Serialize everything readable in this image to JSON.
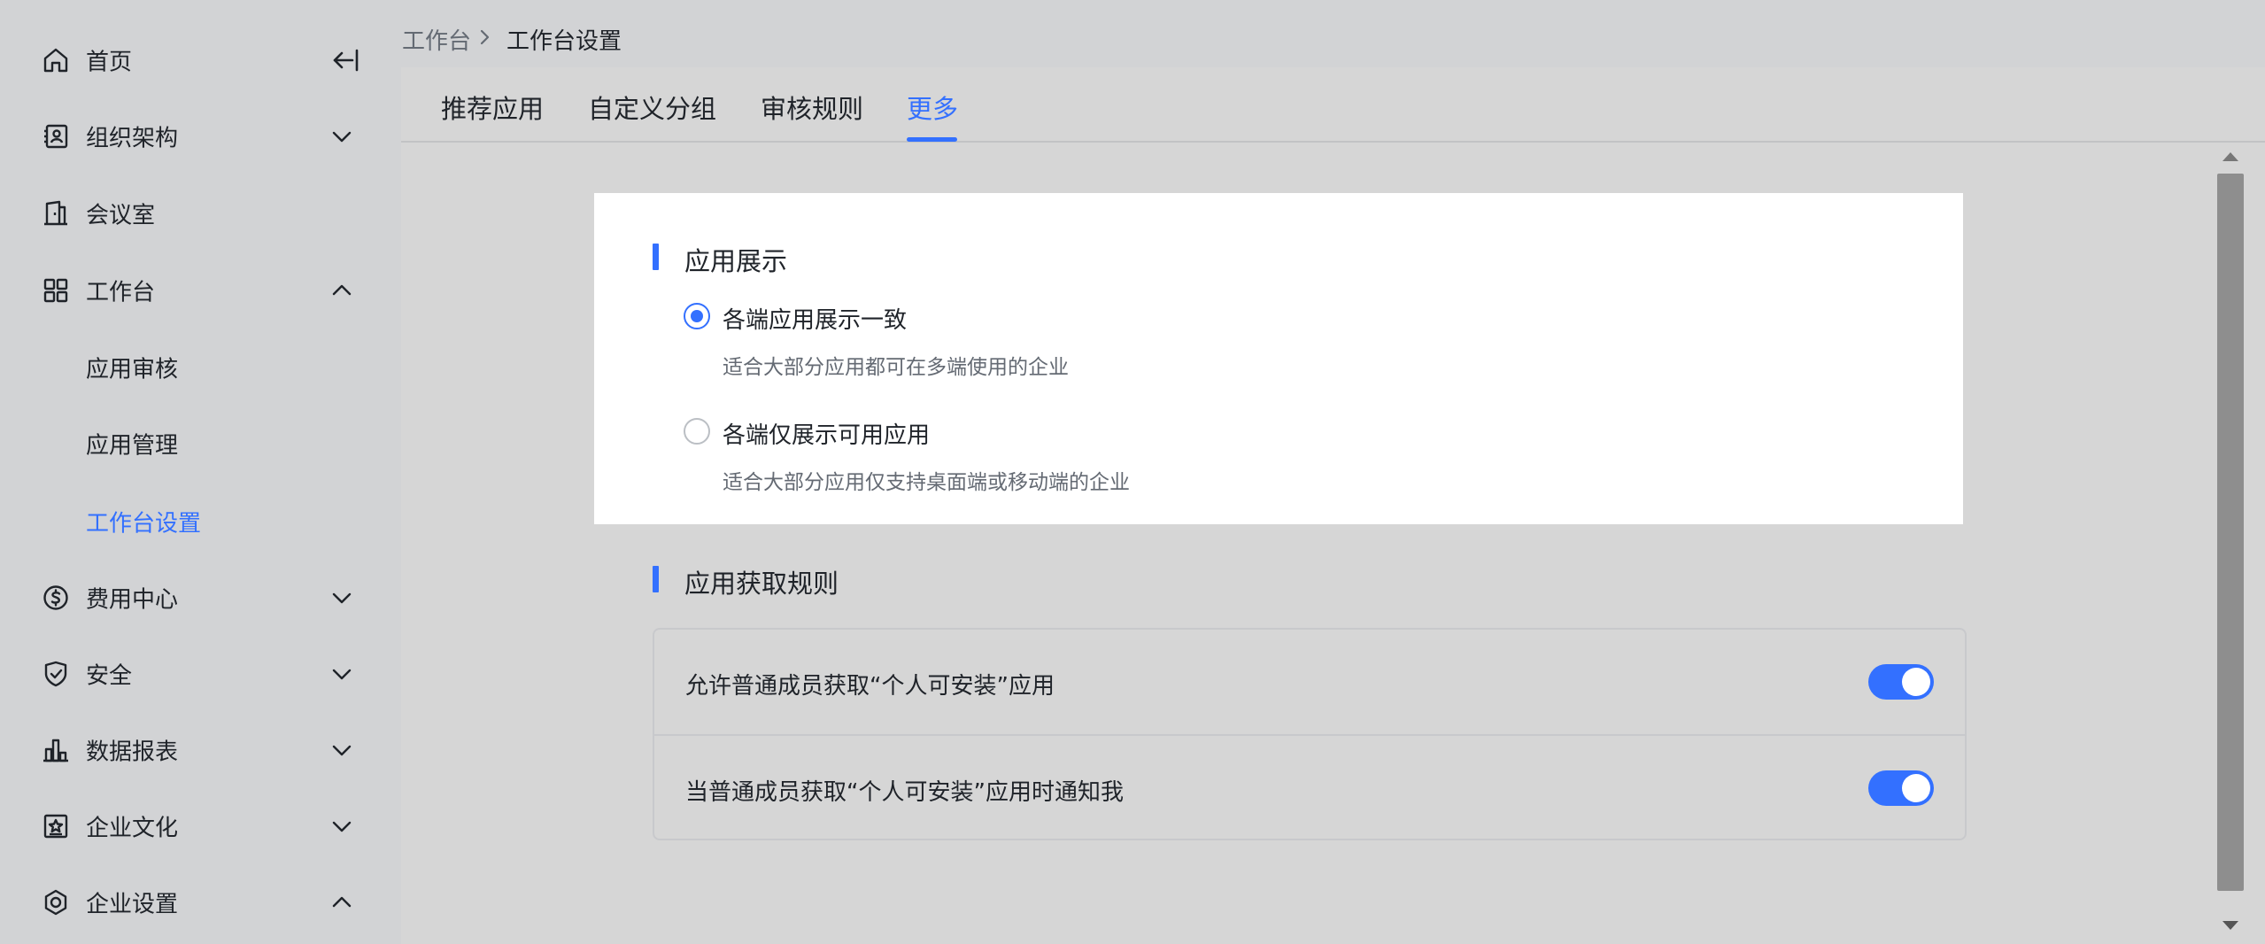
{
  "sidebar": {
    "items": [
      {
        "label": "首页",
        "icon": "home-icon"
      },
      {
        "label": "组织架构",
        "icon": "org-icon"
      },
      {
        "label": "会议室",
        "icon": "meeting-room-icon"
      },
      {
        "label": "工作台",
        "icon": "grid-icon"
      },
      {
        "label": "应用审核"
      },
      {
        "label": "应用管理"
      },
      {
        "label": "工作台设置"
      },
      {
        "label": "费用中心",
        "icon": "dollar-icon"
      },
      {
        "label": "安全",
        "icon": "shield-icon"
      },
      {
        "label": "数据报表",
        "icon": "bar-chart-icon"
      },
      {
        "label": "企业文化",
        "icon": "culture-icon"
      },
      {
        "label": "企业设置",
        "icon": "gear-icon"
      }
    ],
    "active_item": "工作台设置"
  },
  "breadcrumb": {
    "items": [
      "工作台",
      "工作台设置"
    ]
  },
  "tabs": [
    "推荐应用",
    "自定义分组",
    "审核规则",
    "更多"
  ],
  "active_tab": "更多",
  "display_section": {
    "title": "应用展示",
    "options": [
      {
        "label": "各端应用展示一致",
        "desc": "适合大部分应用都可在多端使用的企业",
        "checked": true
      },
      {
        "label": "各端仅展示可用应用",
        "desc": "适合大部分应用仅支持桌面端或移动端的企业",
        "checked": false
      }
    ]
  },
  "acquire_section": {
    "title": "应用获取规则",
    "rules": [
      {
        "label": "允许普通成员获取“个人可安装”应用",
        "enabled": true
      },
      {
        "label": "当普通成员获取“个人可安装”应用时通知我",
        "enabled": true
      }
    ]
  },
  "colors": {
    "accent": "#3370ff",
    "sidebar_bg": "#d2d3d5",
    "content_bg": "#d6d6d6"
  }
}
